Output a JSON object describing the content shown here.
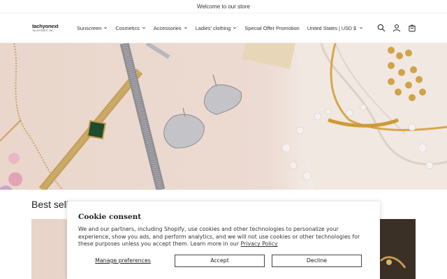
{
  "announcement": "Welcome to our store",
  "logo": {
    "name": "tachyonext",
    "tagline": "TACHYONEXT INC."
  },
  "nav": [
    {
      "label": "Sunscreen",
      "has_dropdown": true
    },
    {
      "label": "Cosmetics",
      "has_dropdown": true
    },
    {
      "label": "Accessories",
      "has_dropdown": true
    },
    {
      "label": "Ladies' clothing",
      "has_dropdown": true
    },
    {
      "label": "Special Offer Promotion",
      "has_dropdown": false
    }
  ],
  "country_selector": "United States | USD $",
  "icons": {
    "search": "search-icon",
    "account": "account-icon",
    "cart": "cart-icon"
  },
  "section_title": "Best selle",
  "cookie": {
    "title": "Cookie consent",
    "body": "We and our partners, including Shopify, use cookies and other technologies to personalize your experience, show you ads, and perform analytics, and we will not use cookies or other technologies for these purposes unless you accept them. Learn more in our ",
    "policy_link": "Privacy Policy",
    "manage": "Manage preferences",
    "accept": "Accept",
    "decline": "Decline"
  }
}
